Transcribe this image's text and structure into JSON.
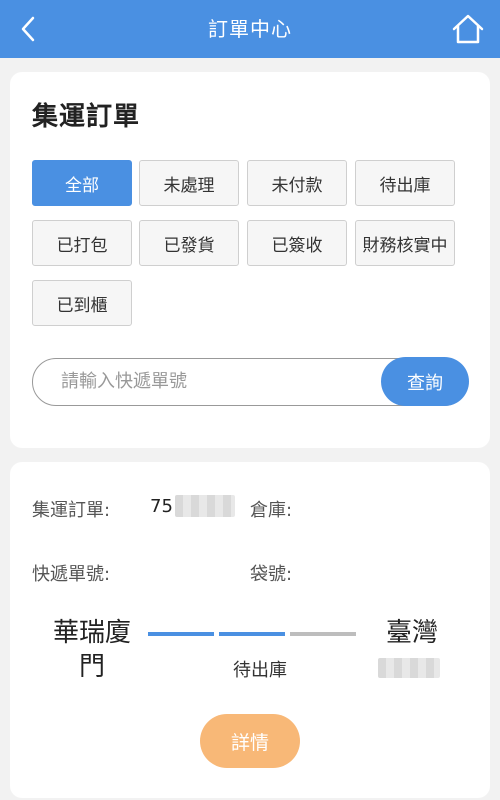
{
  "header": {
    "title": "訂單中心",
    "back_icon": "chevron-left-icon",
    "home_icon": "home-icon",
    "bg_color": "#4a90e2"
  },
  "filter_card": {
    "title": "集運訂單",
    "filters": [
      {
        "label": "全部",
        "active": true
      },
      {
        "label": "未處理",
        "active": false
      },
      {
        "label": "未付款",
        "active": false
      },
      {
        "label": "待出庫",
        "active": false
      },
      {
        "label": "已打包",
        "active": false
      },
      {
        "label": "已發貨",
        "active": false
      },
      {
        "label": "已簽收",
        "active": false
      },
      {
        "label": "財務核實中",
        "active": false
      },
      {
        "label": "已到櫃",
        "active": false
      }
    ],
    "search": {
      "placeholder": "請輸入快遞單號",
      "button_label": "查詢"
    }
  },
  "order_card": {
    "order_label": "集運訂單:",
    "order_number_visible": "75",
    "warehouse_label": "倉庫:",
    "tracking_label": "快遞單號:",
    "bag_label": "袋號:",
    "origin_line1": "華瑞廈",
    "origin_line2": "門",
    "destination": "臺灣",
    "status": "待出庫",
    "progress_steps_completed": 2,
    "progress_steps_total": 3,
    "details_label": "詳情",
    "colors": {
      "progress_done": "#4a90e2",
      "progress_pending": "#bdbdbd",
      "details_button": "#f8b877"
    }
  }
}
